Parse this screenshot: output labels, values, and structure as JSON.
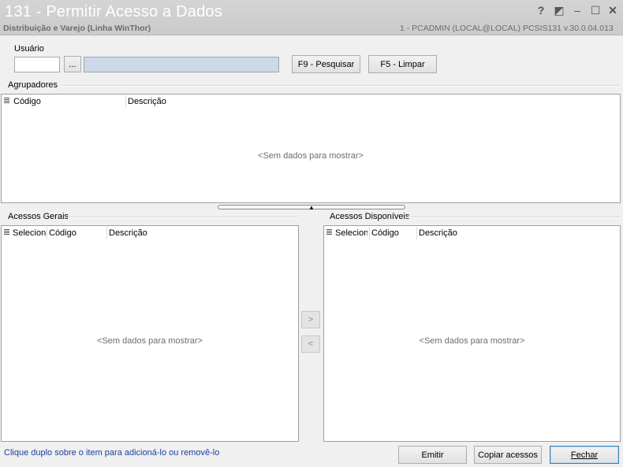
{
  "window": {
    "title": "131 - Permitir Acesso a Dados",
    "subtitle": "Distribuição e Varejo (Linha WinThor)",
    "connection": "1 - PCADMIN (LOCAL@LOCAL)   PCSIS131  v.30.0.04.013",
    "help_glyph": "?",
    "restore_glyph": "◩",
    "minimize_glyph": "–",
    "maximize_glyph": "☐",
    "close_glyph": "✕"
  },
  "usuario": {
    "label": "Usuário",
    "code_value": "",
    "browse_label": "...",
    "name_value": "",
    "search_button": "F9 - Pesquisar",
    "clear_button": "F5 - Limpar"
  },
  "agrupadores": {
    "label": "Agrupadores",
    "columns": [
      "Código",
      "Descrição"
    ],
    "empty_text": "<Sem dados para mostrar>"
  },
  "acessos_gerais": {
    "label": "Acessos Gerais",
    "columns": [
      "Selecionar",
      "Código",
      "Descrição"
    ],
    "empty_text": "<Sem dados para mostrar>"
  },
  "acessos_disponiveis": {
    "label": "Acessos Disponíveis",
    "columns": [
      "Selecionar",
      "Código",
      "Descrição"
    ],
    "empty_text": "<Sem dados para mostrar>"
  },
  "transfer": {
    "add_label": ">",
    "remove_label": "<"
  },
  "footer": {
    "hint": "Clique duplo sobre o item para adicioná-lo ou removê-lo",
    "emitir": "Emitir",
    "copiar": "Copiar acessos",
    "fechar": "Fechar"
  }
}
